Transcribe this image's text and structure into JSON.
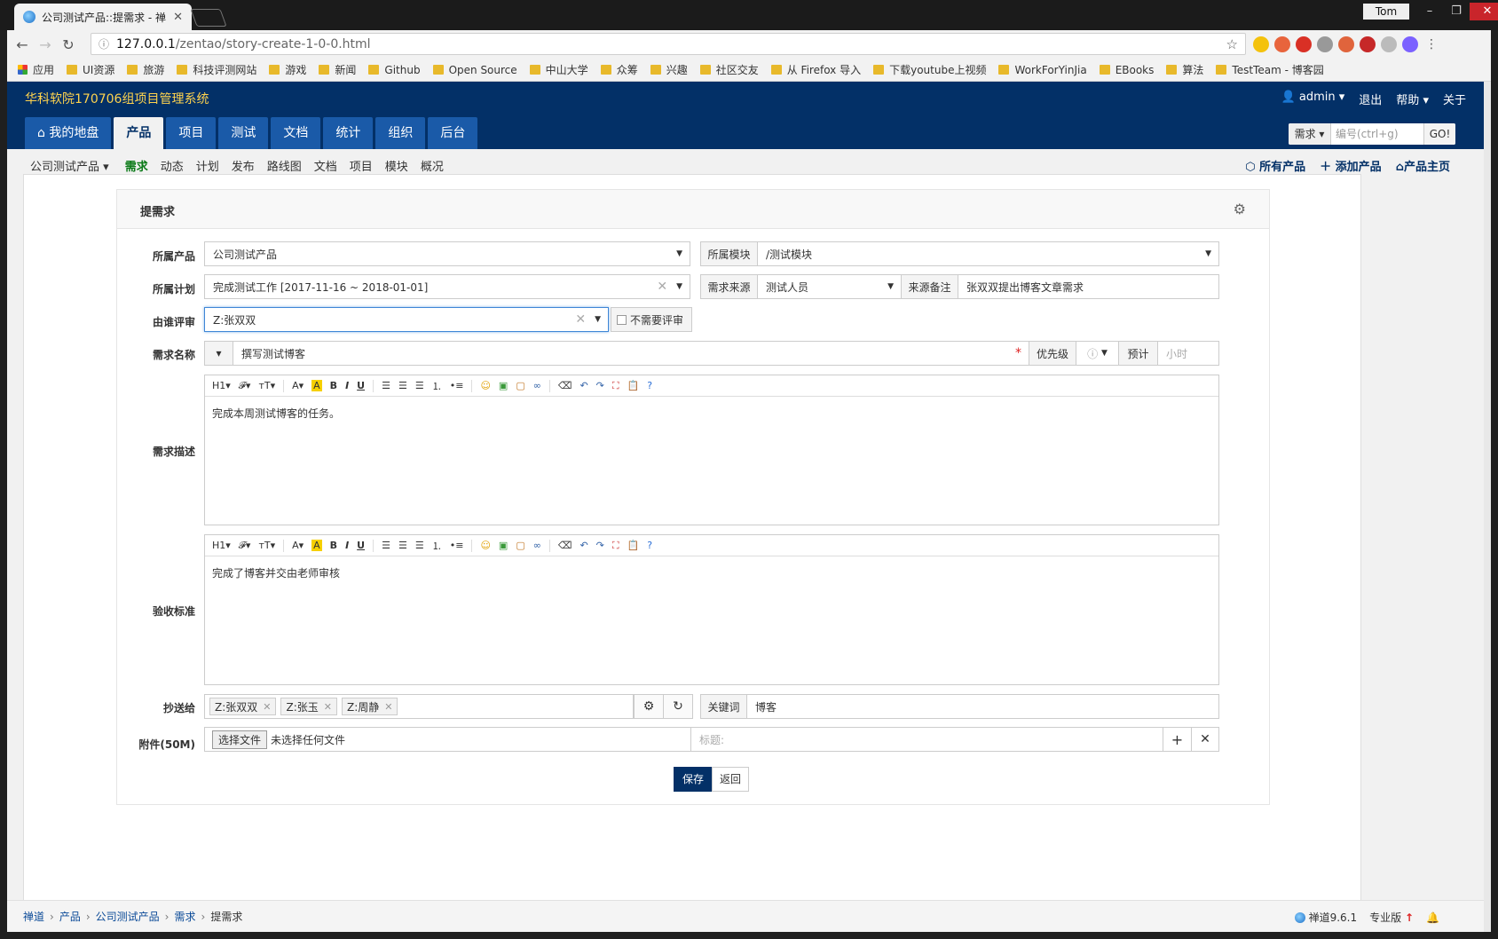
{
  "browser": {
    "tab_title": "公司测试产品::提需求 - 禅",
    "user": "Tom",
    "url_host": "127.0.0.1",
    "url_path": "/zentao/story-create-1-0-0.html",
    "bookmarks": [
      "应用",
      "UI资源",
      "旅游",
      "科技评测网站",
      "游戏",
      "新闻",
      "Github",
      "Open Source",
      "中山大学",
      "众筹",
      "兴趣",
      "社区交友",
      "从 Firefox 导入",
      "下载youtube上视频",
      "WorkForYinJia",
      "EBooks",
      "算法",
      "TestTeam - 博客园"
    ]
  },
  "header": {
    "brand": "华科软院170706组项目管理系统",
    "user": "admin",
    "logout": "退出",
    "help": "帮助",
    "about": "关于",
    "nav": [
      "我的地盘",
      "产品",
      "项目",
      "测试",
      "文档",
      "统计",
      "组织",
      "后台"
    ],
    "search_type": "需求",
    "search_placeholder": "编号(ctrl+g)",
    "search_go": "GO!"
  },
  "subnav": {
    "product": "公司测试产品",
    "items": [
      "需求",
      "动态",
      "计划",
      "发布",
      "路线图",
      "文档",
      "项目",
      "模块",
      "概况"
    ],
    "right": [
      "所有产品",
      "添加产品",
      "产品主页"
    ]
  },
  "form": {
    "title": "提需求",
    "labels": {
      "product": "所属产品",
      "plan": "所属计划",
      "reviewer": "由谁评审",
      "name": "需求名称",
      "desc": "需求描述",
      "accept": "验收标准",
      "mailto": "抄送给",
      "files": "附件(50M)"
    },
    "product": "公司测试产品",
    "module_label": "所属模块",
    "module": "/测试模块",
    "plan": "完成测试工作 [2017-11-16 ~ 2018-01-01]",
    "source_label": "需求来源",
    "source": "测试人员",
    "source_note_label": "来源备注",
    "source_note": "张双双提出博客文章需求",
    "reviewer": "Z:张双双",
    "no_review": "不需要评审",
    "story_name": "撰写测试博客",
    "priority_label": "优先级",
    "estimate_label": "预计",
    "estimate_placeholder": "小时",
    "desc_text": "完成本周测试博客的任务。",
    "accept_text": "完成了博客并交由老师审核",
    "mailto": [
      "Z:张双双",
      "Z:张玉",
      "Z:周静"
    ],
    "keywords_label": "关键词",
    "keywords": "博客",
    "choose_file": "选择文件",
    "no_file": "未选择任何文件",
    "file_title_placeholder": "标题:",
    "save": "保存",
    "back": "返回"
  },
  "footer": {
    "crumbs": [
      "禅道",
      "产品",
      "公司测试产品",
      "需求",
      "提需求"
    ],
    "version": "禅道9.6.1",
    "edition": "专业版"
  }
}
